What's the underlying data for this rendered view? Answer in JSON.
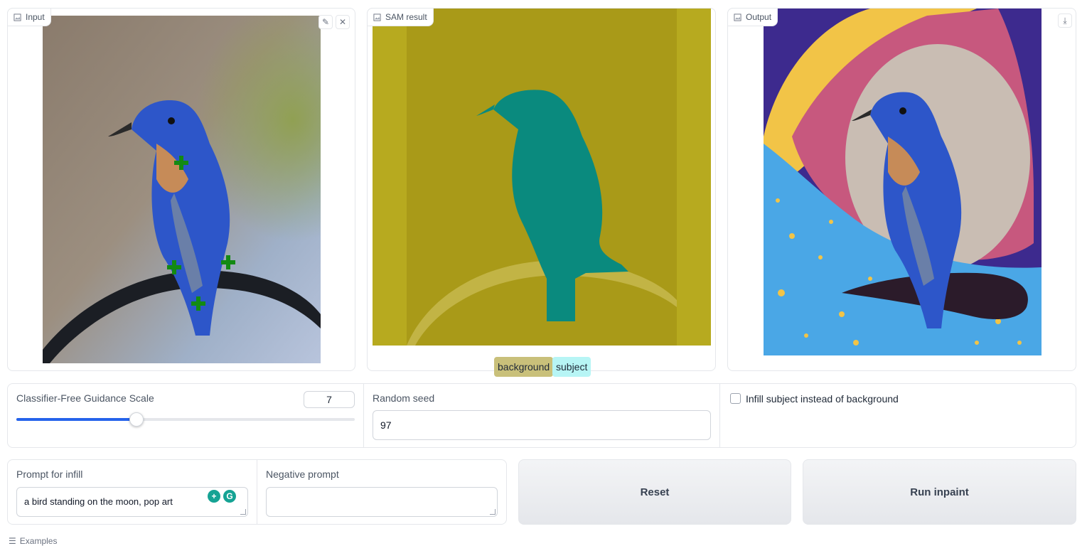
{
  "panels": {
    "input": {
      "label": "Input",
      "image_icon": "image-icon",
      "edit_icon": "pencil-icon",
      "close_icon": "close-icon"
    },
    "sam": {
      "label": "SAM result",
      "image_icon": "image-icon",
      "legend": [
        {
          "label": "background",
          "color": "#c9c07a"
        },
        {
          "label": "subject",
          "color": "#b7f5f5"
        }
      ]
    },
    "output": {
      "label": "Output",
      "image_icon": "image-icon",
      "download_icon": "download-icon"
    }
  },
  "controls": {
    "guidance": {
      "label": "Classifier-Free Guidance Scale",
      "value": "7",
      "fraction": 0.37
    },
    "seed": {
      "label": "Random seed",
      "value": "97"
    },
    "infill_subject": {
      "label": "Infill subject instead of background",
      "checked": false
    }
  },
  "prompts": {
    "prompt": {
      "label": "Prompt for infill",
      "value": "a bird standing on the moon, pop art"
    },
    "negative": {
      "label": "Negative prompt",
      "value": ""
    }
  },
  "buttons": {
    "reset": "Reset",
    "run": "Run inpaint"
  },
  "examples": {
    "label": "Examples"
  },
  "colors": {
    "accent": "#2563eb",
    "marker": "#138a13",
    "mask_background": "#b7a71c",
    "mask_subject": "#00807a"
  }
}
